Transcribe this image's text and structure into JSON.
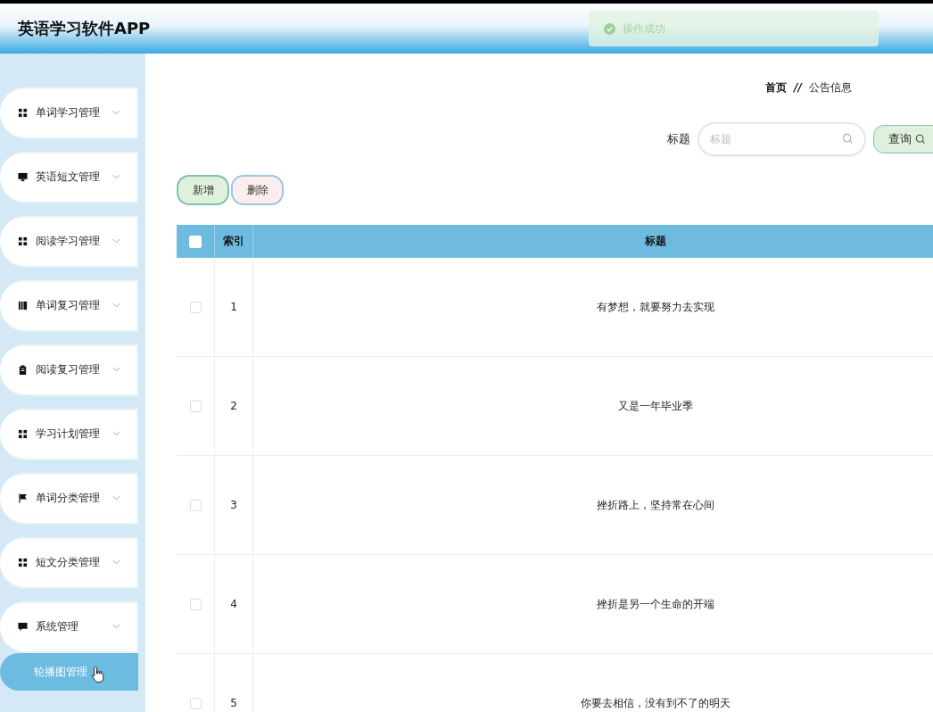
{
  "header": {
    "title": "英语学习软件APP"
  },
  "toast": {
    "message": "操作成功"
  },
  "sidebar": {
    "items": [
      {
        "label": "单词学习管理"
      },
      {
        "label": "英语短文管理"
      },
      {
        "label": "阅读学习管理"
      },
      {
        "label": "单词复习管理"
      },
      {
        "label": "阅读复习管理"
      },
      {
        "label": "学习计划管理"
      },
      {
        "label": "单词分类管理"
      },
      {
        "label": "短文分类管理"
      },
      {
        "label": "系统管理",
        "children": [
          {
            "label": "轮播图管理",
            "selected": true
          }
        ]
      }
    ]
  },
  "breadcrumb": {
    "home": "首页",
    "separator": "//",
    "current": "公告信息"
  },
  "search": {
    "label": "标题",
    "placeholder": "标题",
    "button": "查询"
  },
  "actions": [
    "新增",
    "删除"
  ],
  "table": {
    "columns": [
      "索引",
      "标题"
    ],
    "all_checked": false,
    "rows": [
      {
        "checked": false,
        "index": "1",
        "title": "有梦想，就要努力去实现"
      },
      {
        "checked": false,
        "index": "2",
        "title": "又是一年毕业季"
      },
      {
        "checked": false,
        "index": "3",
        "title": "挫折路上，坚持常在心间"
      },
      {
        "checked": false,
        "index": "4",
        "title": "挫折是另一个生命的开端"
      },
      {
        "checked": false,
        "index": "5",
        "title": "你要去相信，没有到不了的明天"
      }
    ]
  }
}
